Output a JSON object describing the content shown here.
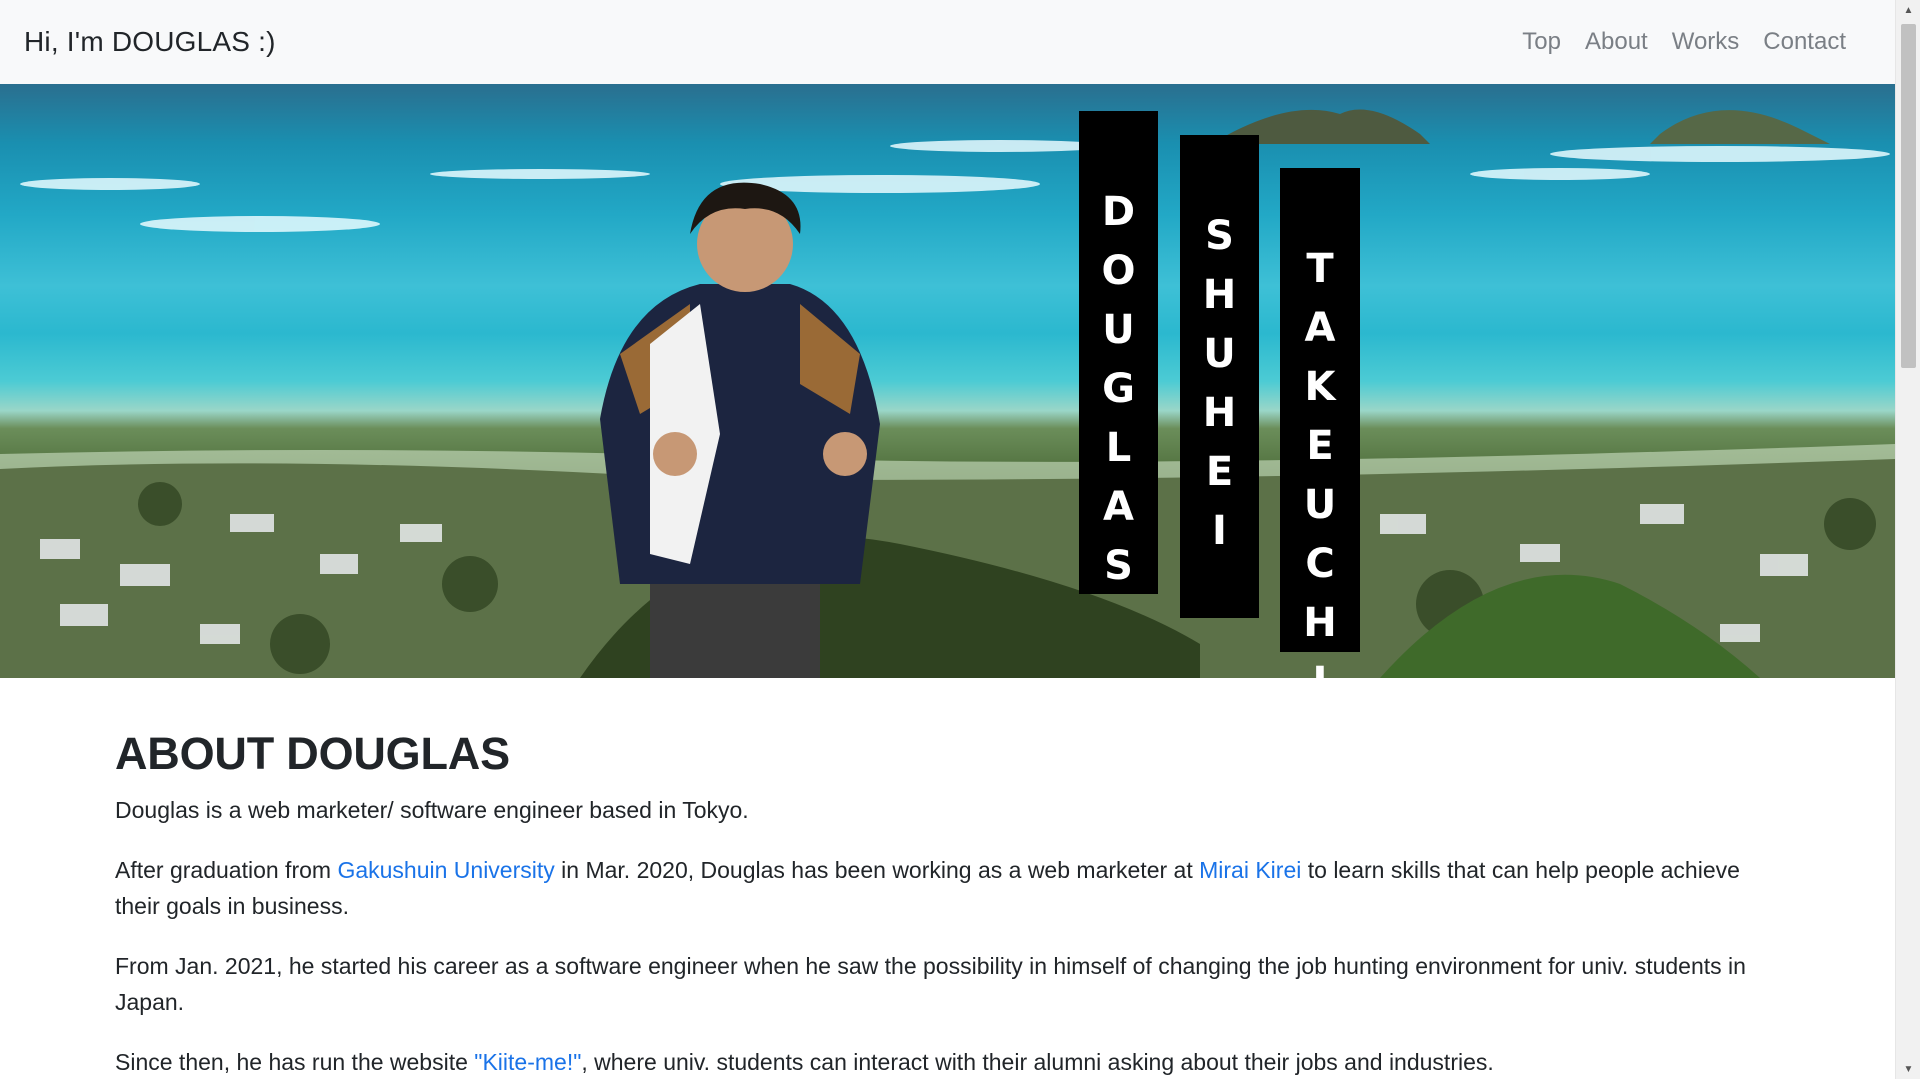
{
  "navbar": {
    "brand": "Hi, I'm DOUGLAS :)",
    "links": [
      {
        "label": "Top"
      },
      {
        "label": "About"
      },
      {
        "label": "Works"
      },
      {
        "label": "Contact"
      }
    ]
  },
  "hero": {
    "name_bars": [
      {
        "text": "DOUGLAS",
        "letters": [
          "D",
          "O",
          "U",
          "G",
          "L",
          "A",
          "S"
        ]
      },
      {
        "text": "SHUHEI",
        "letters": [
          "S",
          "H",
          "U",
          "H",
          "E",
          "I"
        ]
      },
      {
        "text": "TAKEUCHI",
        "letters": [
          "T",
          "A",
          "K",
          "E",
          "U",
          "C",
          "H",
          "I"
        ]
      }
    ]
  },
  "about": {
    "title": "ABOUT DOUGLAS",
    "p1": "Douglas is a web marketer/ software engineer based in Tokyo.",
    "p2": {
      "before": "After graduation from ",
      "link1": "Gakushuin University",
      "middle": " in Mar. 2020, Douglas has been working as a web marketer at ",
      "link2": "Mirai Kirei",
      "after": " to learn skills that can help people achieve their goals in business."
    },
    "p3": "From Jan. 2021, he started his career as a software engineer when he saw the possibility in himself of changing the job hunting environment for univ. students in Japan.",
    "p4": {
      "before": "Since then, he has run the website ",
      "link": "\"Kiite-me!\"",
      "after": ", where univ. students can interact with their alumni asking about their jobs and industries."
    }
  },
  "colors": {
    "link": "#1a73e8",
    "nav_text": "#7a7f85",
    "navbar_bg": "#f8f9fa",
    "bar_bg": "#000000"
  }
}
